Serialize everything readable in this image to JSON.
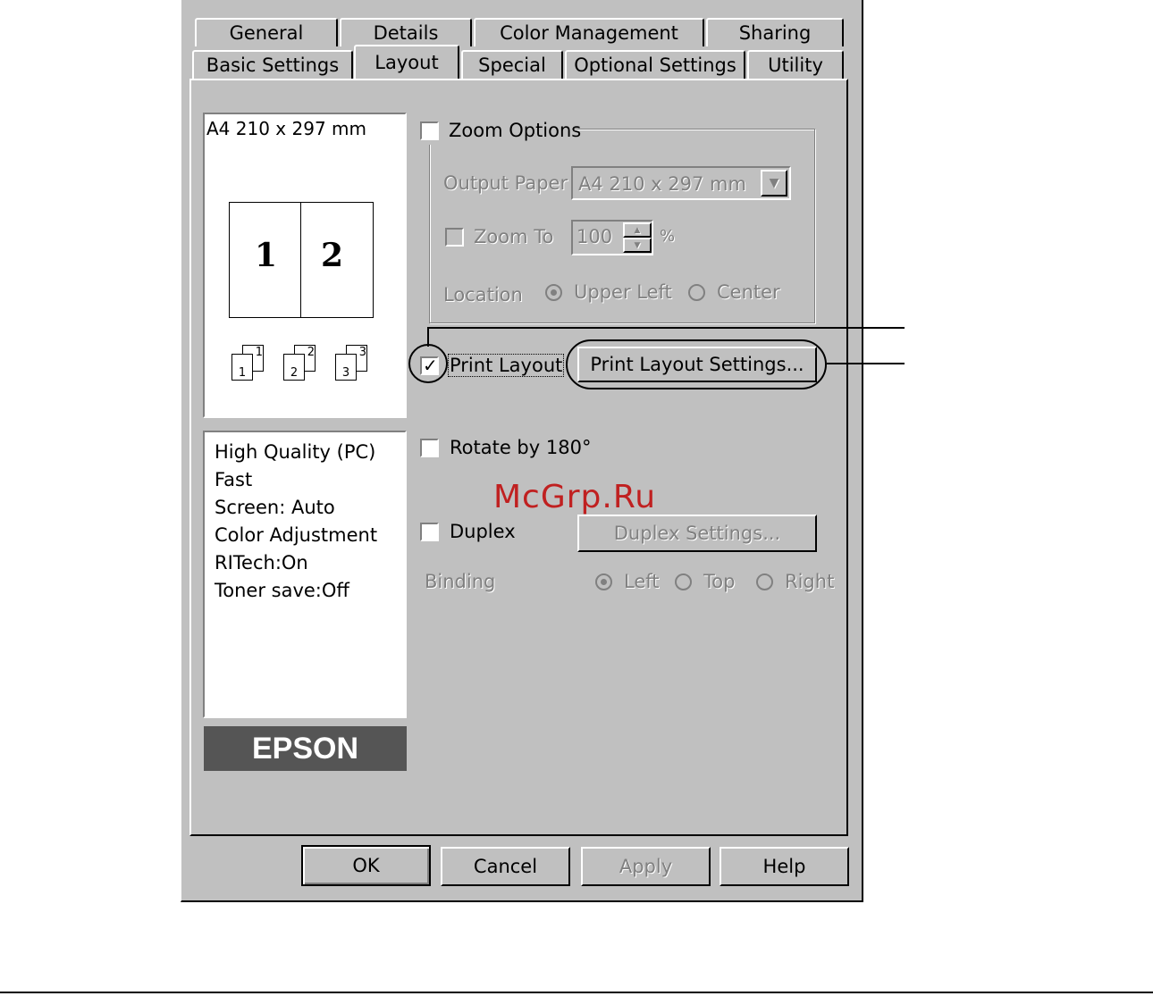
{
  "tabs_row1": [
    "General",
    "Details",
    "Color Management",
    "Sharing"
  ],
  "tabs_row2": [
    "Basic Settings",
    "Layout",
    "Special",
    "Optional Settings",
    "Utility"
  ],
  "preview": {
    "paper_label": "A4 210 x 297 mm",
    "page_numbers": [
      "1",
      "2"
    ],
    "copy_icon_labels": [
      "1",
      "1",
      "2",
      "2",
      "3",
      "3"
    ]
  },
  "info_list": [
    "High Quality (PC)",
    "Fast",
    "Screen: Auto",
    "Color Adjustment",
    "RITech:On",
    "Toner save:Off"
  ],
  "brand": "EPSON",
  "zoom": {
    "label": "Zoom Options",
    "output_paper_label": "Output Paper",
    "output_paper_value": "A4 210 x 297 mm",
    "zoom_to_label": "Zoom To",
    "zoom_to_value": "100",
    "percent": "%",
    "location_label": "Location",
    "upper_left": "Upper Left",
    "center": "Center"
  },
  "print_layout": {
    "label": "Print Layout",
    "settings_button": "Print Layout Settings..."
  },
  "rotate": "Rotate by 180°",
  "watermark": "McGrp.Ru",
  "duplex": {
    "label": "Duplex",
    "settings_button": "Duplex Settings...",
    "binding_label": "Binding",
    "left": "Left",
    "top": "Top",
    "right": "Right"
  },
  "buttons": {
    "ok": "OK",
    "cancel": "Cancel",
    "apply": "Apply",
    "help": "Help"
  },
  "colors": {
    "face": "#c0c0c0",
    "shadow": "#808080",
    "brand_bg": "#555555",
    "watermark": "#c02020"
  }
}
